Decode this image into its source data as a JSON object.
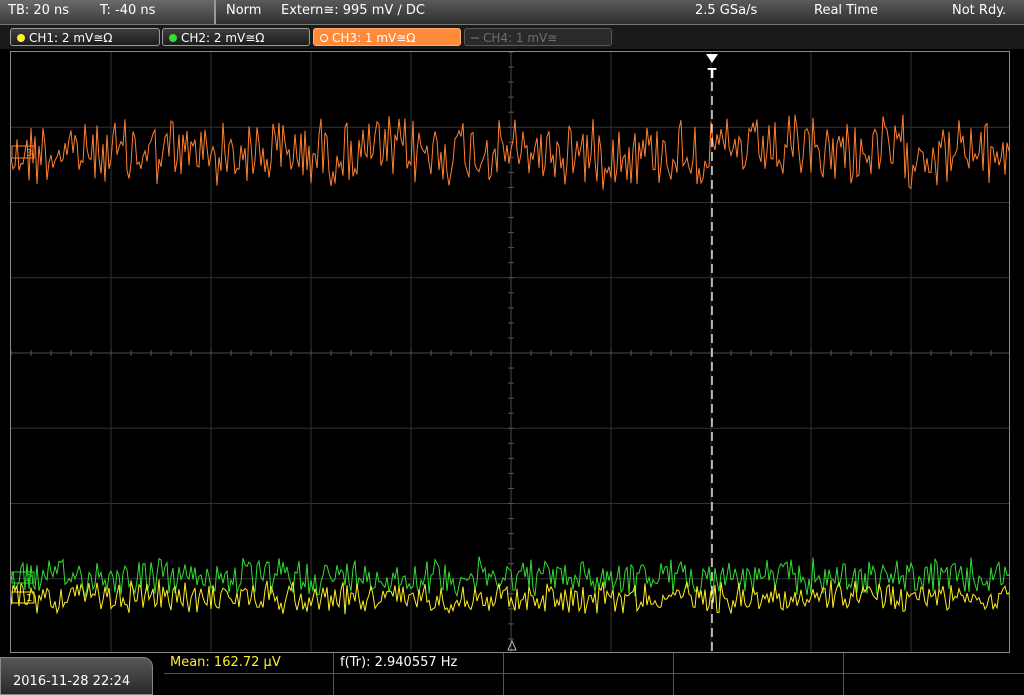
{
  "status_bar": {
    "timebase": "TB: 20 ns",
    "trigger_offset": "T: -40 ns",
    "trigger_mode": "Norm",
    "trigger_source": "Extern≅: 995 mV ∕ DC",
    "sample_rate": "2.5 GSa/s",
    "acq_mode": "Real Time",
    "trigger_status": "Not Rdy."
  },
  "channels": [
    {
      "label": "CH1: 2 mV≅Ω",
      "color": "#ffee33",
      "state": "on"
    },
    {
      "label": "CH2: 2 mV≅Ω",
      "color": "#33dd33",
      "state": "on"
    },
    {
      "label": "CH3: 1 mV≅Ω",
      "color": "#ff8a3a",
      "state": "selected"
    },
    {
      "label": "CH4: 1 mV≅",
      "color": "#555555",
      "state": "off"
    }
  ],
  "markers": {
    "trigger_label": "T",
    "ch3_offset_label": "3",
    "ch1_offset_label": "1",
    "ch2_offset_label": "2"
  },
  "measurements": {
    "mean": "Mean: 162.72 µV",
    "ftr": "f(Tr): 2.940557 Hz"
  },
  "datetime": "2016-11-28 22:24",
  "waveform_colors": {
    "ch1": "#ffee22",
    "ch2": "#33dd33",
    "ch3": "#ff8030"
  }
}
